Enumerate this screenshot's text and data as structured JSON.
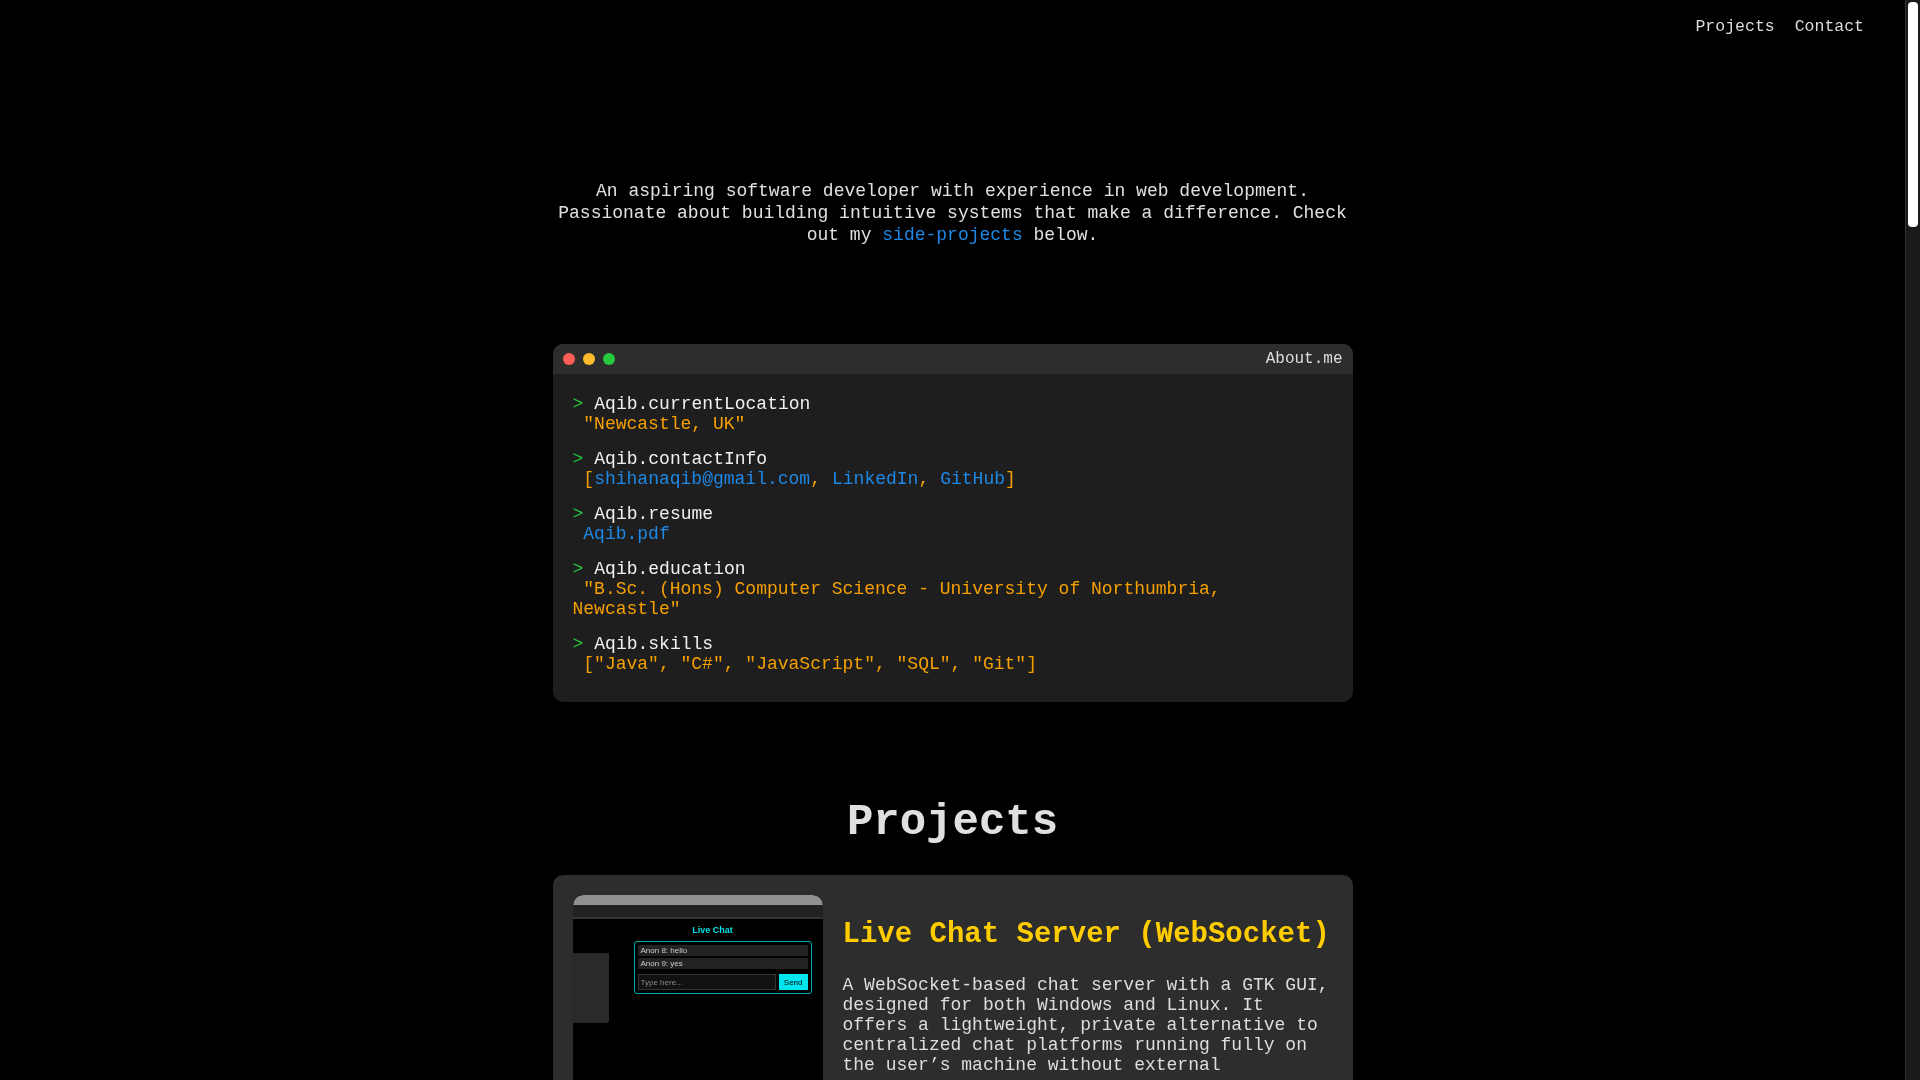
{
  "nav": {
    "links": [
      "Projects",
      "Contact"
    ]
  },
  "intro": {
    "before": "An aspiring software developer with experience in web development. Passionate about building intuitive systems that make a difference. Check out my",
    "link": "side-projects",
    "after": "below."
  },
  "terminal": {
    "title": "About.me",
    "dots": [
      {
        "color": "#ff5f56"
      },
      {
        "color": "#ffbd2e"
      },
      {
        "color": "#27c93f"
      }
    ],
    "entries": [
      {
        "prompt": ">",
        "command": "Aqib.currentLocation",
        "kind": "string",
        "value": "\"Newcastle, UK\""
      },
      {
        "prompt": ">",
        "command": "Aqib.contactInfo",
        "kind": "links",
        "open": "[",
        "close": "]",
        "separator": ",",
        "links": [
          "shihanaqib@gmail.com",
          "LinkedIn",
          "GitHub"
        ]
      },
      {
        "prompt": ">",
        "command": "Aqib.resume",
        "kind": "link",
        "value": "Aqib.pdf"
      },
      {
        "prompt": ">",
        "command": "Aqib.education",
        "kind": "string",
        "value": "\"B.Sc. (Hons) Computer Science - University of Northumbria, Newcastle\""
      },
      {
        "prompt": ">",
        "command": "Aqib.skills",
        "kind": "string",
        "value": "[\"Java\", \"C#\", \"JavaScript\", \"SQL\", \"Git\"]"
      }
    ]
  },
  "projects": {
    "heading": "Projects",
    "items": [
      {
        "title": "Live Chat Server (WebSocket)",
        "description": "A WebSocket-based chat server with a GTK GUI, designed for both Windows and Linux. It offers a lightweight, private alternative to centralized chat platforms running fully on the user’s machine without external",
        "screenshot": {
          "app_title": "Live Chat",
          "messages": [
            "Anon 8: hello",
            "Anon 9: yes"
          ],
          "placeholder": "Type here...",
          "button": "Send"
        }
      }
    ]
  }
}
